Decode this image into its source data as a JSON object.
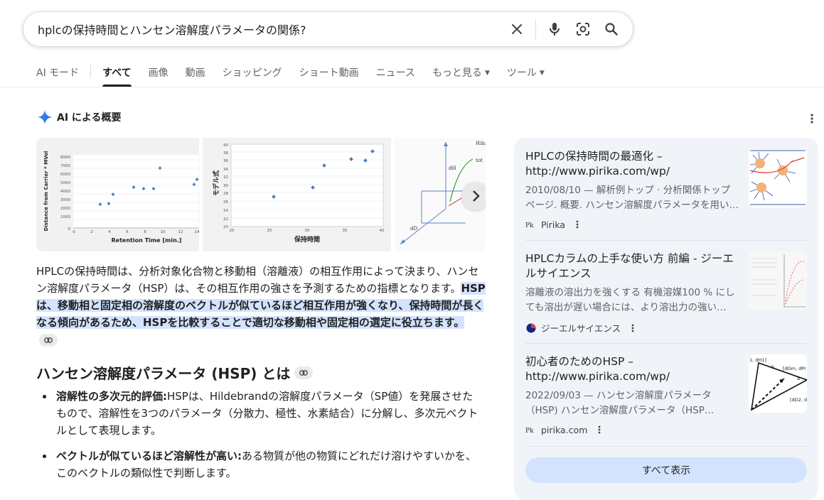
{
  "search": {
    "query": "hplcの保持時間とハンセン溶解度パラメータの関係?"
  },
  "tabs": [
    {
      "label": "AI モード"
    },
    {
      "label": "すべて"
    },
    {
      "label": "画像"
    },
    {
      "label": "動画"
    },
    {
      "label": "ショッピング"
    },
    {
      "label": "ショート動画"
    },
    {
      "label": "ニュース"
    },
    {
      "label": "もっと見る"
    },
    {
      "label": "ツール"
    }
  ],
  "ai_overview": {
    "heading": "AI による概要",
    "image1": {
      "ylabel": "Distance from Carrier * MVol",
      "xlabel": "Retention Time [min.]",
      "yticks": [
        "8000",
        "7000",
        "6000",
        "5000",
        "4000",
        "3000",
        "2000",
        "1000",
        "0"
      ],
      "xticks": [
        "0",
        "2",
        "4",
        "6",
        "8",
        "10",
        "12",
        "14"
      ]
    },
    "image2": {
      "ylabel": "モデル式",
      "xlabel": "保持時間",
      "yticks": [
        "40",
        "38",
        "36",
        "34",
        "32",
        "30",
        "28",
        "26",
        "24",
        "22",
        "20"
      ],
      "xticks": [
        "20",
        "25",
        "30",
        "35",
        "40"
      ]
    },
    "image3": {
      "labels": [
        "dH",
        "dD",
        "Hilde",
        "tot"
      ]
    },
    "paragraph_plain": "HPLCの保持時間は、分析対象化合物と移動相（溶離液）の相互作用によって決まり、ハンセン溶解度パラメータ（HSP）は、その相互作用の強さを予測するための指標となります。",
    "paragraph_highlight": "HSPは、移動相と固定相の溶解度のベクトルが似ているほど相互作用が強くなり、保持時間が長くなる傾向があるため、HSPを比較することで適切な移動相や固定相の選定に役立ちます。",
    "section_title": "ハンセン溶解度パラメータ (HSP) とは",
    "bullets": [
      {
        "bold": "溶解性の多次元的評価:",
        "text": "HSPは、Hildebrandの溶解度パラメータ（SP値）を発展させたもので、溶解性を3つのパラメータ（分散力、極性、水素結合）に分解し、多次元ベクトルとして表現します。"
      },
      {
        "bold": "ベクトルが似ているほど溶解性が高い:",
        "text": "ある物質が他の物質にどれだけ溶けやすいかを、このベクトルの類似性で判断します。"
      }
    ]
  },
  "sources": [
    {
      "title": "HPLCの保持時間の最適化 – http://www.pirika.com/wp/",
      "snippet": "2010/08/10 — 解析例トップ · 分析関係トップページ. 概要. ハンセン溶解度パラメータを用い…",
      "site": "Pirika",
      "favicon": "Pirika"
    },
    {
      "title": "HPLCカラムの上手な使い方 前編 - ジーエルサイエンス",
      "snippet": "溶離液の溶出力を強くする 有機溶媒100 % にしても溶出が遅い場合には、より溶出力の強い…",
      "site": "ジーエルサイエンス",
      "favicon": "gl-sciences-icon"
    },
    {
      "title": "初心者のためのHSP – http://www.pirika.com/wp/",
      "snippet": "2022/09/03 — ハンセン溶解度パラメータ（HSP) ハンセン溶解度パラメータ（HSP…",
      "site": "pirika.com",
      "favicon": "Pirika"
    }
  ],
  "thumb3_labels": {
    "a": "1, dH1]",
    "b": "[dDm, dPr",
    "c": "[dD2, d",
    "d": "b",
    "e": "a"
  },
  "show_all": "すべて表示",
  "colors": {
    "accent": "#1a73e8",
    "highlight": "#d3e3fd",
    "panel": "#f0f4f9",
    "chart_point": "#4a7ebb"
  }
}
